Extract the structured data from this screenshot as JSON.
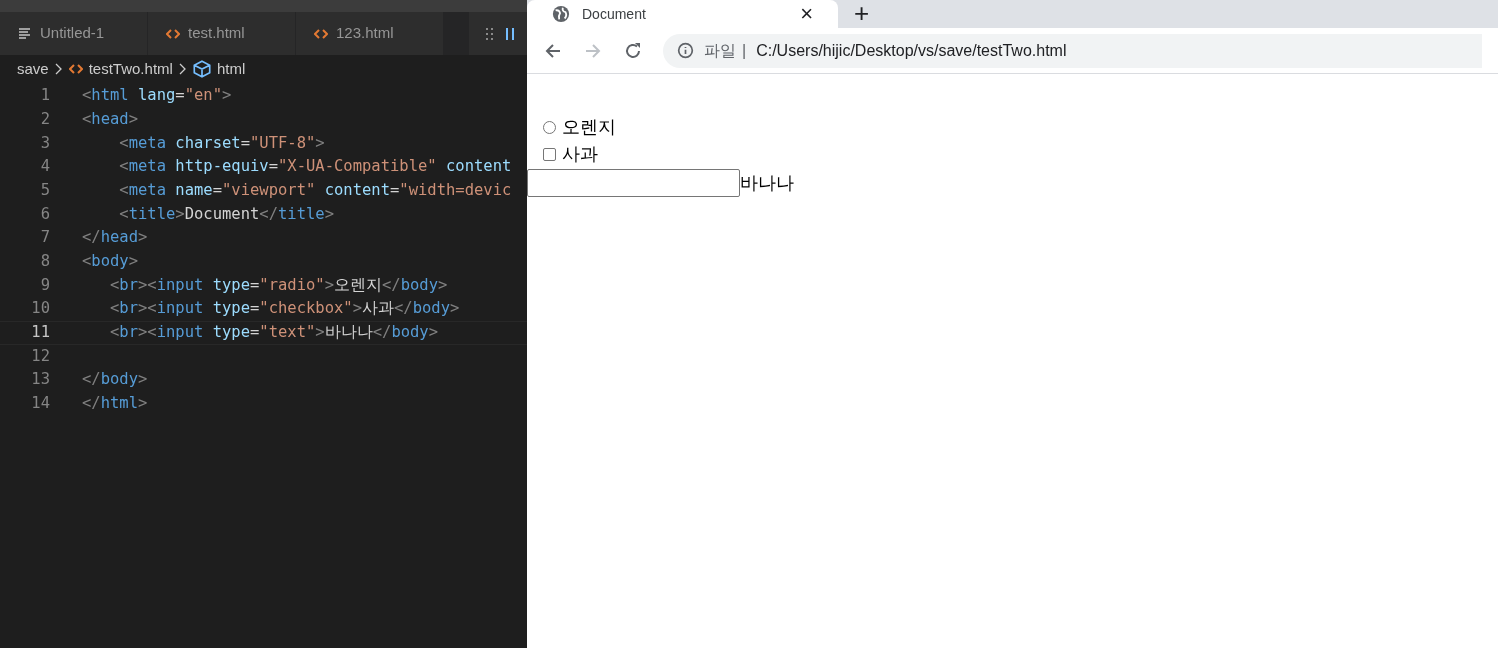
{
  "editor": {
    "tabs": [
      {
        "label": "Untitled-1",
        "kind": "text",
        "selected": false
      },
      {
        "label": "test.html",
        "kind": "html",
        "selected": false
      },
      {
        "label": "123.html",
        "kind": "html",
        "selected": false
      }
    ],
    "breadcrumb": [
      {
        "label": "save",
        "kind": "folder"
      },
      {
        "label": "testTwo.html",
        "kind": "html"
      },
      {
        "label": "html",
        "kind": "element"
      }
    ],
    "lines": [
      {
        "number": "1",
        "current": false,
        "tokens": [
          {
            "kind": "punct",
            "text": "<"
          },
          {
            "kind": "tag",
            "text": "html"
          },
          {
            "kind": "attr",
            "text": " lang"
          },
          {
            "kind": "text",
            "text": "="
          },
          {
            "kind": "str",
            "text": "\"en\""
          },
          {
            "kind": "punct",
            "text": ">"
          }
        ]
      },
      {
        "number": "2",
        "current": false,
        "tokens": [
          {
            "kind": "punct",
            "text": "<"
          },
          {
            "kind": "tag",
            "text": "head"
          },
          {
            "kind": "punct",
            "text": ">"
          }
        ]
      },
      {
        "number": "3",
        "current": false,
        "tokens": [
          {
            "kind": "punct",
            "text": "    <"
          },
          {
            "kind": "tag",
            "text": "meta"
          },
          {
            "kind": "attr",
            "text": " charset"
          },
          {
            "kind": "text",
            "text": "="
          },
          {
            "kind": "str",
            "text": "\"UTF-8\""
          },
          {
            "kind": "punct",
            "text": ">"
          }
        ]
      },
      {
        "number": "4",
        "current": false,
        "tokens": [
          {
            "kind": "punct",
            "text": "    <"
          },
          {
            "kind": "tag",
            "text": "meta"
          },
          {
            "kind": "attr",
            "text": " http-equiv"
          },
          {
            "kind": "text",
            "text": "="
          },
          {
            "kind": "str",
            "text": "\"X-UA-Compatible\""
          },
          {
            "kind": "attr",
            "text": " content"
          }
        ]
      },
      {
        "number": "5",
        "current": false,
        "tokens": [
          {
            "kind": "punct",
            "text": "    <"
          },
          {
            "kind": "tag",
            "text": "meta"
          },
          {
            "kind": "attr",
            "text": " name"
          },
          {
            "kind": "text",
            "text": "="
          },
          {
            "kind": "str",
            "text": "\"viewport\""
          },
          {
            "kind": "attr",
            "text": " content"
          },
          {
            "kind": "text",
            "text": "="
          },
          {
            "kind": "str",
            "text": "\"width=devic"
          }
        ]
      },
      {
        "number": "6",
        "current": false,
        "tokens": [
          {
            "kind": "punct",
            "text": "    <"
          },
          {
            "kind": "tag",
            "text": "title"
          },
          {
            "kind": "punct",
            "text": ">"
          },
          {
            "kind": "text",
            "text": "Document"
          },
          {
            "kind": "punct",
            "text": "</"
          },
          {
            "kind": "tag",
            "text": "title"
          },
          {
            "kind": "punct",
            "text": ">"
          }
        ]
      },
      {
        "number": "7",
        "current": false,
        "tokens": [
          {
            "kind": "punct",
            "text": "</"
          },
          {
            "kind": "tag",
            "text": "head"
          },
          {
            "kind": "punct",
            "text": ">"
          }
        ]
      },
      {
        "number": "8",
        "current": false,
        "tokens": [
          {
            "kind": "punct",
            "text": "<"
          },
          {
            "kind": "tag",
            "text": "body"
          },
          {
            "kind": "punct",
            "text": ">"
          }
        ]
      },
      {
        "number": "9",
        "current": false,
        "tokens": [
          {
            "kind": "punct",
            "text": "   <"
          },
          {
            "kind": "tag",
            "text": "br"
          },
          {
            "kind": "punct",
            "text": "><"
          },
          {
            "kind": "tag",
            "text": "input"
          },
          {
            "kind": "attr",
            "text": " type"
          },
          {
            "kind": "text",
            "text": "="
          },
          {
            "kind": "str",
            "text": "\"radio\""
          },
          {
            "kind": "punct",
            "text": ">"
          },
          {
            "kind": "text",
            "text": "오렌지"
          },
          {
            "kind": "punct",
            "text": "</"
          },
          {
            "kind": "tag",
            "text": "body"
          },
          {
            "kind": "punct",
            "text": ">"
          }
        ]
      },
      {
        "number": "10",
        "current": false,
        "tokens": [
          {
            "kind": "punct",
            "text": "   <"
          },
          {
            "kind": "tag",
            "text": "br"
          },
          {
            "kind": "punct",
            "text": "><"
          },
          {
            "kind": "tag",
            "text": "input"
          },
          {
            "kind": "attr",
            "text": " type"
          },
          {
            "kind": "text",
            "text": "="
          },
          {
            "kind": "str",
            "text": "\"checkbox\""
          },
          {
            "kind": "punct",
            "text": ">"
          },
          {
            "kind": "text",
            "text": "사과"
          },
          {
            "kind": "punct",
            "text": "</"
          },
          {
            "kind": "tag",
            "text": "body"
          },
          {
            "kind": "punct",
            "text": ">"
          }
        ]
      },
      {
        "number": "11",
        "current": true,
        "tokens": [
          {
            "kind": "punct",
            "text": "   <"
          },
          {
            "kind": "tag",
            "text": "br"
          },
          {
            "kind": "punct",
            "text": "><"
          },
          {
            "kind": "tag",
            "text": "input"
          },
          {
            "kind": "attr",
            "text": " type"
          },
          {
            "kind": "text",
            "text": "="
          },
          {
            "kind": "str",
            "text": "\"text\""
          },
          {
            "kind": "punct",
            "text": ">"
          },
          {
            "kind": "text",
            "text": "바나나"
          },
          {
            "kind": "punct",
            "text": "</"
          },
          {
            "kind": "tag",
            "text": "body"
          },
          {
            "kind": "punct",
            "text": ">"
          }
        ]
      },
      {
        "number": "12",
        "current": false
      },
      {
        "number": "13",
        "current": false,
        "tokens": [
          {
            "kind": "punct",
            "text": "</"
          },
          {
            "kind": "tag",
            "text": "body"
          },
          {
            "kind": "punct",
            "text": ">"
          }
        ]
      },
      {
        "number": "14",
        "current": false,
        "tokens": [
          {
            "kind": "punct",
            "text": "</"
          },
          {
            "kind": "tag",
            "text": "html"
          },
          {
            "kind": "punct",
            "text": ">"
          }
        ]
      }
    ]
  },
  "browser": {
    "tab_title": "Document",
    "close_glyph": "×",
    "new_tab_glyph": "+",
    "address_scheme": "파일",
    "separator": "|",
    "url": "C:/Users/hijic/Desktop/vs/save/testTwo.html",
    "page": [
      {
        "kind": "radio",
        "label": "오렌지",
        "checked": false
      },
      {
        "kind": "checkbox",
        "label": "사과",
        "checked": false
      },
      {
        "kind": "text",
        "label": "바나나"
      }
    ]
  }
}
